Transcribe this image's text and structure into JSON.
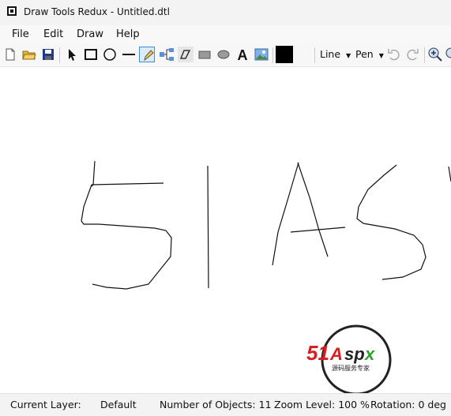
{
  "window": {
    "title": "Draw Tools Redux - Untitled.dtl"
  },
  "menu": [
    "File",
    "Edit",
    "Draw",
    "Help"
  ],
  "toolbar": {
    "line_style_label": "Line",
    "pen_style_label": "Pen",
    "current_color": "#000000",
    "active_tool": "pencil"
  },
  "watermark": {
    "text_main": "51Aspx",
    "text_sub": "源码服务专家"
  },
  "status": {
    "layer_label": "Current Layer:",
    "layer_value": "Default",
    "objects": "Number of Objects:  11",
    "zoom": "Zoom Level:  100 %",
    "rotation": "Rotation:  0 deg"
  }
}
